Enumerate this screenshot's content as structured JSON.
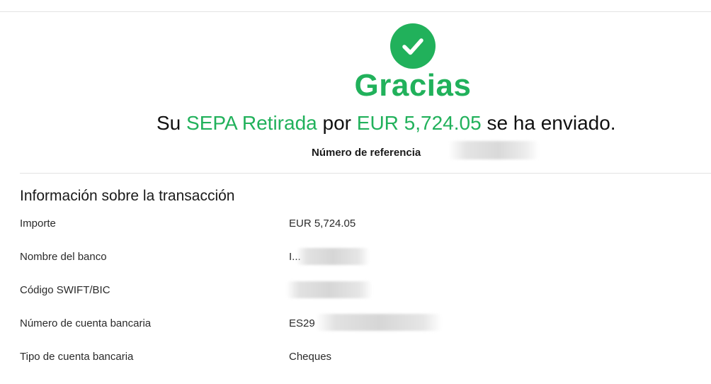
{
  "confirmation": {
    "title": "Gracias",
    "message": {
      "prefix": "Su",
      "method": "SEPA Retirada",
      "connector": "por",
      "amount": "EUR 5,724.05",
      "suffix": "se ha enviado."
    },
    "reference_label": "Número de referencia",
    "icon": "check-circle-icon"
  },
  "transaction_info": {
    "heading": "Información sobre la transacción",
    "rows": [
      {
        "label": "Importe",
        "value": "EUR 5,724.05"
      },
      {
        "label": "Nombre del banco",
        "value": "I..."
      },
      {
        "label": "Código SWIFT/BIC",
        "value": ""
      },
      {
        "label": "Número de cuenta bancaria",
        "value": "ES29"
      },
      {
        "label": "Tipo de cuenta bancaria",
        "value": "Cheques"
      }
    ]
  },
  "colors": {
    "accent": "#21b15b",
    "text": "#111111",
    "divider": "#e3e3e3"
  }
}
